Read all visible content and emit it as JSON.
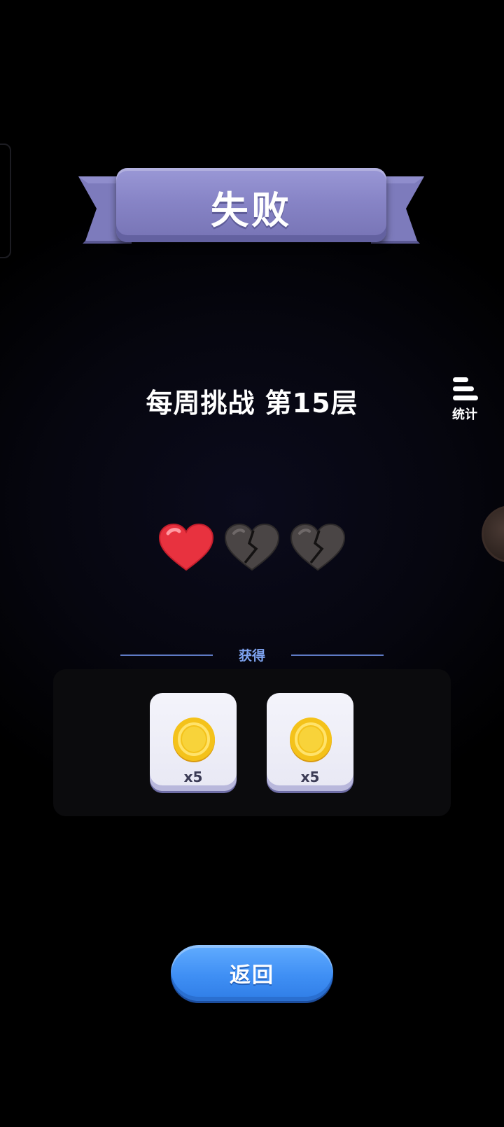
{
  "banner": {
    "title": "失败"
  },
  "level": {
    "subtitle": "每周挑战 第15层"
  },
  "stats_button": {
    "label": "统计",
    "icon": "stats-list-icon"
  },
  "lives": {
    "total": 3,
    "remaining": 1,
    "hearts": [
      {
        "state": "full",
        "icon": "red-heart-icon"
      },
      {
        "state": "broken",
        "icon": "broken-heart-icon"
      },
      {
        "state": "broken",
        "icon": "broken-heart-icon"
      }
    ]
  },
  "rewards": {
    "title": "获得",
    "items": [
      {
        "icon": "gold-coin-icon",
        "count": "x5"
      },
      {
        "icon": "gold-coin-icon",
        "count": "x5"
      }
    ]
  },
  "return_button": {
    "label": "返回"
  },
  "colors": {
    "banner": "#8784c6",
    "heart_full": "#e8323f",
    "heart_broken": "#4a4545",
    "reward_accent": "#7ea3f0",
    "button": "#3f8ff4",
    "coin": "#f4c21a"
  }
}
